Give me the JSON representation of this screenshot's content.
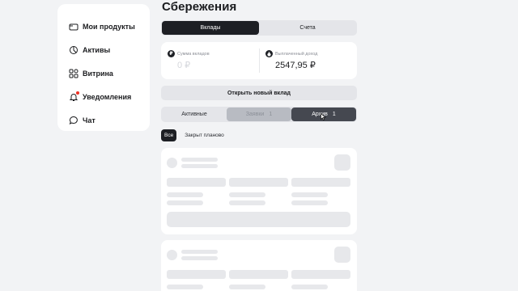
{
  "sidebar": {
    "items": [
      {
        "label": "Мои продукты",
        "icon": "card-icon"
      },
      {
        "label": "Активы",
        "icon": "pie-chart-icon"
      },
      {
        "label": "Витрина",
        "icon": "grid-icon"
      },
      {
        "label": "Уведомления",
        "icon": "bell-icon"
      },
      {
        "label": "Чат",
        "icon": "chat-bubble-icon"
      }
    ]
  },
  "page": {
    "title": "Сбережения"
  },
  "segment": {
    "tabs": [
      {
        "label": "Вклады",
        "active": true
      },
      {
        "label": "Счета",
        "active": false
      }
    ]
  },
  "summary": {
    "deposits_label": "Сумма вкладов",
    "deposits_value": "0 ₽",
    "deposits_icon": "ruble-icon",
    "income_label": "Выплаченный доход",
    "income_value": "2547,95 ₽",
    "income_icon": "money-bag-icon"
  },
  "actions": {
    "open_deposit": "Открыть новый вклад"
  },
  "status_tabs": [
    {
      "label": "Активные",
      "count": ""
    },
    {
      "label": "Заявки",
      "count": "1"
    },
    {
      "label": "Архив",
      "count": "1",
      "selected": true
    }
  ],
  "filters": {
    "chips": [
      {
        "label": "Все",
        "active": true
      },
      {
        "label": "Закрыт планово",
        "active": false
      }
    ]
  },
  "colors": {
    "background": "#f2f3f5",
    "dark": "#1d1f24",
    "notification_dot": "#ef3124",
    "skeleton": "#e7e8eb"
  }
}
